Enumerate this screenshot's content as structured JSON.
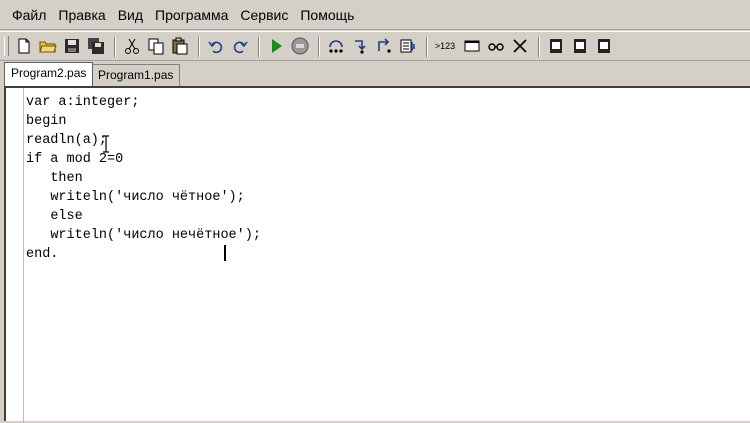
{
  "menu": {
    "items": [
      "Файл",
      "Правка",
      "Вид",
      "Программа",
      "Сервис",
      "Помощь"
    ]
  },
  "toolbar": {
    "buttons": [
      {
        "name": "new-file-icon"
      },
      {
        "name": "open-folder-icon"
      },
      {
        "name": "save-icon"
      },
      {
        "name": "save-all-icon"
      },
      {
        "name": "cut-icon"
      },
      {
        "name": "copy-icon"
      },
      {
        "name": "paste-icon"
      },
      {
        "name": "undo-icon"
      },
      {
        "name": "redo-icon"
      },
      {
        "name": "run-icon"
      },
      {
        "name": "stop-icon"
      },
      {
        "name": "step-over-icon"
      },
      {
        "name": "step-into-icon"
      },
      {
        "name": "step-out-icon"
      },
      {
        "name": "watch-icon"
      },
      {
        "name": "evaluate-icon"
      },
      {
        "name": "window-icon"
      },
      {
        "name": "glasses-icon"
      },
      {
        "name": "tools-icon"
      },
      {
        "name": "doc1-icon"
      },
      {
        "name": "doc2-icon"
      },
      {
        "name": "doc3-icon"
      }
    ],
    "evaluate_label": ">123",
    "accent_run": "#1e8a1e",
    "accent_blue": "#1f3f8f"
  },
  "tabs": [
    {
      "label": "Program2.pas",
      "active": true
    },
    {
      "label": "Program1.pas",
      "active": false
    }
  ],
  "editor": {
    "lines": [
      {
        "indent": "",
        "text": "var a:integer;"
      },
      {
        "indent": "",
        "text": "begin"
      },
      {
        "indent": "",
        "text": "readln(a);"
      },
      {
        "indent": "",
        "text": "if a mod 2=0"
      },
      {
        "indent": "   ",
        "text": "then"
      },
      {
        "indent": "   ",
        "text": "writeln('число чётное');"
      },
      {
        "indent": "   ",
        "text": "else"
      },
      {
        "indent": "   ",
        "text": "writeln('число нечётное');"
      },
      {
        "indent": "",
        "text": "end."
      }
    ]
  }
}
